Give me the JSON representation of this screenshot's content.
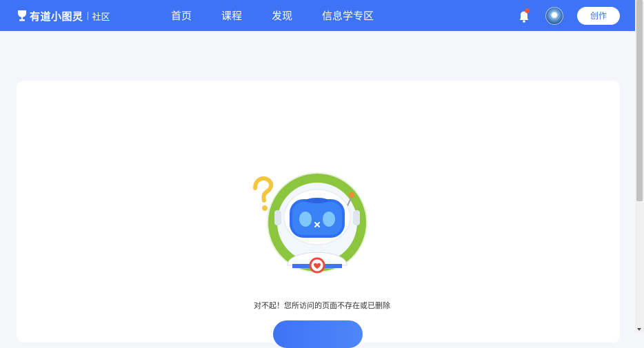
{
  "header": {
    "brand": "有道小图灵",
    "section": "社区",
    "nav": [
      {
        "label": "首页"
      },
      {
        "label": "课程"
      },
      {
        "label": "发现"
      },
      {
        "label": "信息学专区"
      }
    ],
    "create_label": "创作",
    "icons": {
      "logo": "trophy-cup-icon",
      "notification": "bell-icon"
    }
  },
  "error": {
    "message": "对不起！您所访问的页面不存在或已删除",
    "illustration": "robot-question-illustration"
  },
  "colors": {
    "header_bg": "#3f73f5",
    "page_bg": "#f5f6fa",
    "badge": "#f0553c",
    "illustration_ring": "#8cc63f"
  }
}
